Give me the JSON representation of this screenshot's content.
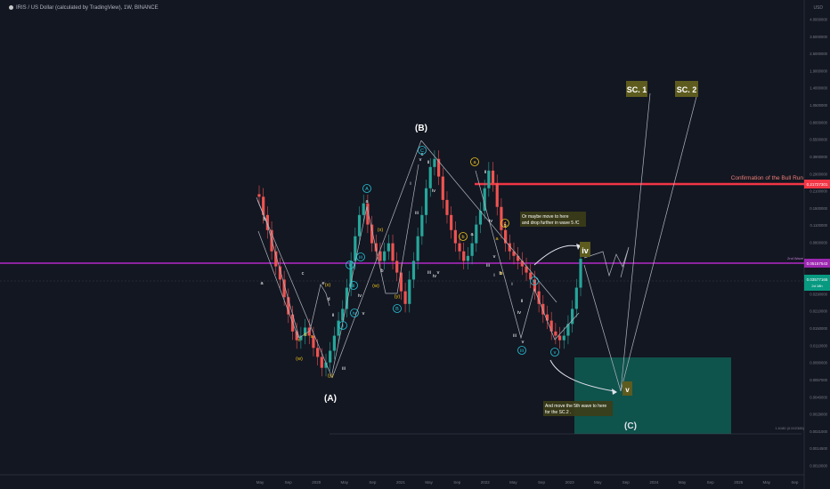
{
  "header": {
    "symbol_line": "IRIS / US Dollar (calculated by TradingView), 1W, BINANCE"
  },
  "axis": {
    "currency": "USD"
  },
  "chart_data": {
    "type": "line",
    "title": "IRIS / US Dollar (calculated by TradingView), 1W, BINANCE",
    "scale": "log",
    "ylim": [
      0.001,
      5.0
    ],
    "grid": false,
    "x_tick_labels": [
      "May",
      "Sep",
      "2020",
      "May",
      "Sep",
      "2021",
      "May",
      "Sep",
      "2022",
      "May",
      "Sep",
      "2023",
      "May",
      "Sep",
      "2024",
      "May",
      "Sep",
      "2025",
      "May",
      "Sep"
    ],
    "y_tick_labels": [
      "4.0000000",
      "3.5000000",
      "2.5000000",
      "1.9000000",
      "1.4000000",
      "1.0500000",
      "0.8000000",
      "0.5500000",
      "0.3900000",
      "0.2900000",
      "0.2100000",
      "0.1500000",
      "0.1100000",
      "0.0800000",
      "0.0570000",
      "0.0400000",
      "0.0290000",
      "0.0210000",
      "0.0150000",
      "0.0110000",
      "0.0080000",
      "0.0057000",
      "0.0040000",
      "0.0029000",
      "0.0021000",
      "0.0014500",
      "0.0010000"
    ],
    "price_lines": [
      {
        "label": "Confirmation of the Bull Run",
        "value": "0.21727301",
        "color": "#f23645"
      },
      {
        "label": "2nd Wave",
        "value": "0.05157543",
        "color": "#9c27b0"
      }
    ],
    "current_price": {
      "value": "0.03577165",
      "sub": "2d 18h"
    },
    "box_label": "1.6180 (0.002385)",
    "annotations": {
      "A": "(A)",
      "B": "(B)",
      "C": "(C)",
      "iv": "iv",
      "v": "v",
      "sc1": "SC. 1",
      "sc2": "SC. 2",
      "note_top_1": "Or maybe move to here",
      "note_top_2": "and drop further in wave 5 /C",
      "note_bottom_1": "And move the 5th wave to here",
      "note_bottom_2": "for the SC.2 ."
    },
    "wave_labels_white": [
      "a",
      "b",
      "c",
      "a",
      "b",
      "c",
      "i",
      "ii",
      "iii",
      "iv",
      "v",
      "i",
      "ii",
      "iii",
      "iv",
      "v",
      "iii",
      "iv",
      "v",
      "a",
      "b",
      "c",
      "d",
      "e",
      "ii",
      "iii",
      "iv",
      "v",
      "i",
      "ii",
      "iii",
      "iv",
      "v"
    ],
    "wave_labels_yellow": [
      "(w)",
      "(x)",
      "(y)",
      "(w)",
      "(x)",
      "(y)",
      "c",
      "b",
      "a",
      "c",
      "b",
      "a"
    ],
    "wave_labels_circled_cyan": [
      "A",
      "B",
      "C",
      "i",
      "ii",
      "iii",
      "iv",
      "v",
      "iv",
      "v",
      "iii"
    ],
    "wave_labels_circled_yellow": [
      "a",
      "b",
      "c"
    ],
    "series": [
      {
        "name": "IRIS/USD",
        "values": [
          0.17,
          0.12,
          0.09,
          0.06,
          0.045,
          0.035,
          0.025,
          0.018,
          0.013,
          0.011,
          0.012,
          0.014,
          0.012,
          0.0095,
          0.008,
          0.0065,
          0.0072,
          0.009,
          0.012,
          0.016,
          0.02,
          0.03,
          0.05,
          0.08,
          0.12,
          0.15,
          0.1,
          0.07,
          0.06,
          0.05,
          0.06,
          0.07,
          0.05,
          0.04,
          0.028,
          0.022,
          0.035,
          0.05,
          0.08,
          0.12,
          0.2,
          0.3,
          0.35,
          0.25,
          0.16,
          0.12,
          0.09,
          0.07,
          0.06,
          0.05,
          0.055,
          0.07,
          0.1,
          0.13,
          0.2,
          0.28,
          0.22,
          0.14,
          0.09,
          0.07,
          0.06,
          0.055,
          0.05,
          0.045,
          0.04,
          0.035,
          0.028,
          0.022,
          0.018,
          0.016,
          0.013,
          0.012,
          0.011,
          0.012,
          0.015,
          0.02,
          0.03,
          0.052
        ]
      }
    ]
  }
}
